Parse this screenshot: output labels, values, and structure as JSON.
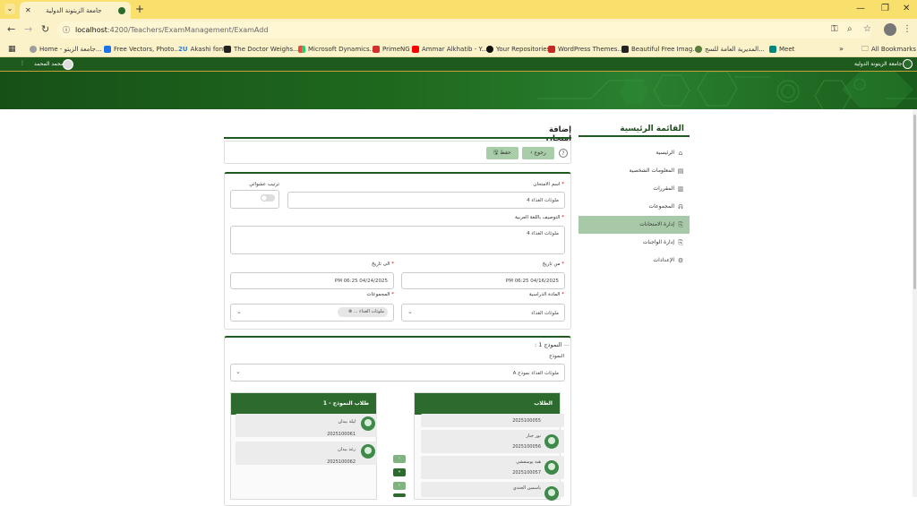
{
  "browser": {
    "tab_title": "جامعة الزيتونة الدولية",
    "url_host": "localhost",
    "url_rest": ":4200/Teachers/ExamManagement/ExamAdd",
    "bookmarks": [
      {
        "label": "Home - جامعة الزيتو...",
        "color": "#9e9e9e"
      },
      {
        "label": "Free Vectors, Photo...",
        "color": "#1a73e8"
      },
      {
        "label": "Akashi font",
        "color": "#2a7de1"
      },
      {
        "label": "The Doctor Weighs...",
        "color": "#222222"
      },
      {
        "label": "Microsoft Dynamics...",
        "color": "#e74c3c"
      },
      {
        "label": "PrimeNG",
        "color": "#d32f2f"
      },
      {
        "label": "Ammar Alkhatib - Y...",
        "color": "#ff0000"
      },
      {
        "label": "Your Repositories",
        "color": "#111111"
      },
      {
        "label": "WordPress Themes...",
        "color": "#c62828"
      },
      {
        "label": "Beautiful Free Imag...",
        "color": "#222222"
      },
      {
        "label": "المديرية العامة للسج...",
        "color": "#5b7d3a"
      },
      {
        "label": "Meet",
        "color": "#00897b"
      }
    ],
    "all_bookmarks": "All Bookmarks"
  },
  "header": {
    "user_name": "محمد المحمد",
    "site_name": "جامعة الزيتونة الدولية"
  },
  "sidebar": {
    "title": "القائمة الرئيسية",
    "items": [
      {
        "label": "الرئيسية",
        "icon": "home-icon",
        "glyph": "⌂",
        "active": false
      },
      {
        "label": "المعلومات الشخصية",
        "icon": "id-card-icon",
        "glyph": "▤",
        "active": false
      },
      {
        "label": "المقررات",
        "icon": "book-icon",
        "glyph": "▥",
        "active": false
      },
      {
        "label": "المجموعات",
        "icon": "users-icon",
        "glyph": "ᕱ",
        "active": false
      },
      {
        "label": "إدارة الامتحانات",
        "icon": "exam-icon",
        "glyph": "⎘",
        "active": true
      },
      {
        "label": "إدارة الواجبات",
        "icon": "assignment-icon",
        "glyph": "⎘",
        "active": false
      },
      {
        "label": "الإعدادات",
        "icon": "settings-icon",
        "glyph": "⚙",
        "active": false
      }
    ]
  },
  "page": {
    "title": "إضافة امتحان",
    "back_label": "رجوع",
    "save_label": "حفظ"
  },
  "form": {
    "exam_name_label": "اسم الامتحان",
    "exam_name_value": "ملوثات الغذاء 4",
    "random_order_label": "ترتيب عشوائي",
    "description_label": "التوصيف باللغة العربية",
    "description_value": "ملوثات الغذاء 4",
    "from_date_label": "من تاريخ",
    "from_date_value": "04/16/2025 06:25 PM",
    "to_date_label": "الى تاريخ",
    "to_date_value": "04/24/2025 06:25 PM",
    "subject_label": "المادة الدراسية",
    "subject_value": "ملوثات الغذاء",
    "groups_label": "المجموعات",
    "groups_chip": "ملوثات الغذاء ..."
  },
  "model_section": {
    "legend": "النموذج 1 :",
    "model_label": "النموذج",
    "model_value": "ملوثات الغذاء نموذج A",
    "students_header": "الطلاب",
    "model_students_header": "طلاب النموذج - 1",
    "students": [
      {
        "name": "",
        "id": "2025100055"
      },
      {
        "name": "نور جبار",
        "id": "2025100056"
      },
      {
        "name": "هبة يوسفشي",
        "id": "2025100057"
      },
      {
        "name": "ياسمين الجندي",
        "id": ""
      }
    ],
    "model_students": [
      {
        "name": "ليلة بيدان",
        "id": "2025100061"
      },
      {
        "name": "رغد بيدان",
        "id": "2025100062"
      }
    ],
    "move_buttons": [
      "‹",
      "«",
      "›",
      "»"
    ]
  }
}
